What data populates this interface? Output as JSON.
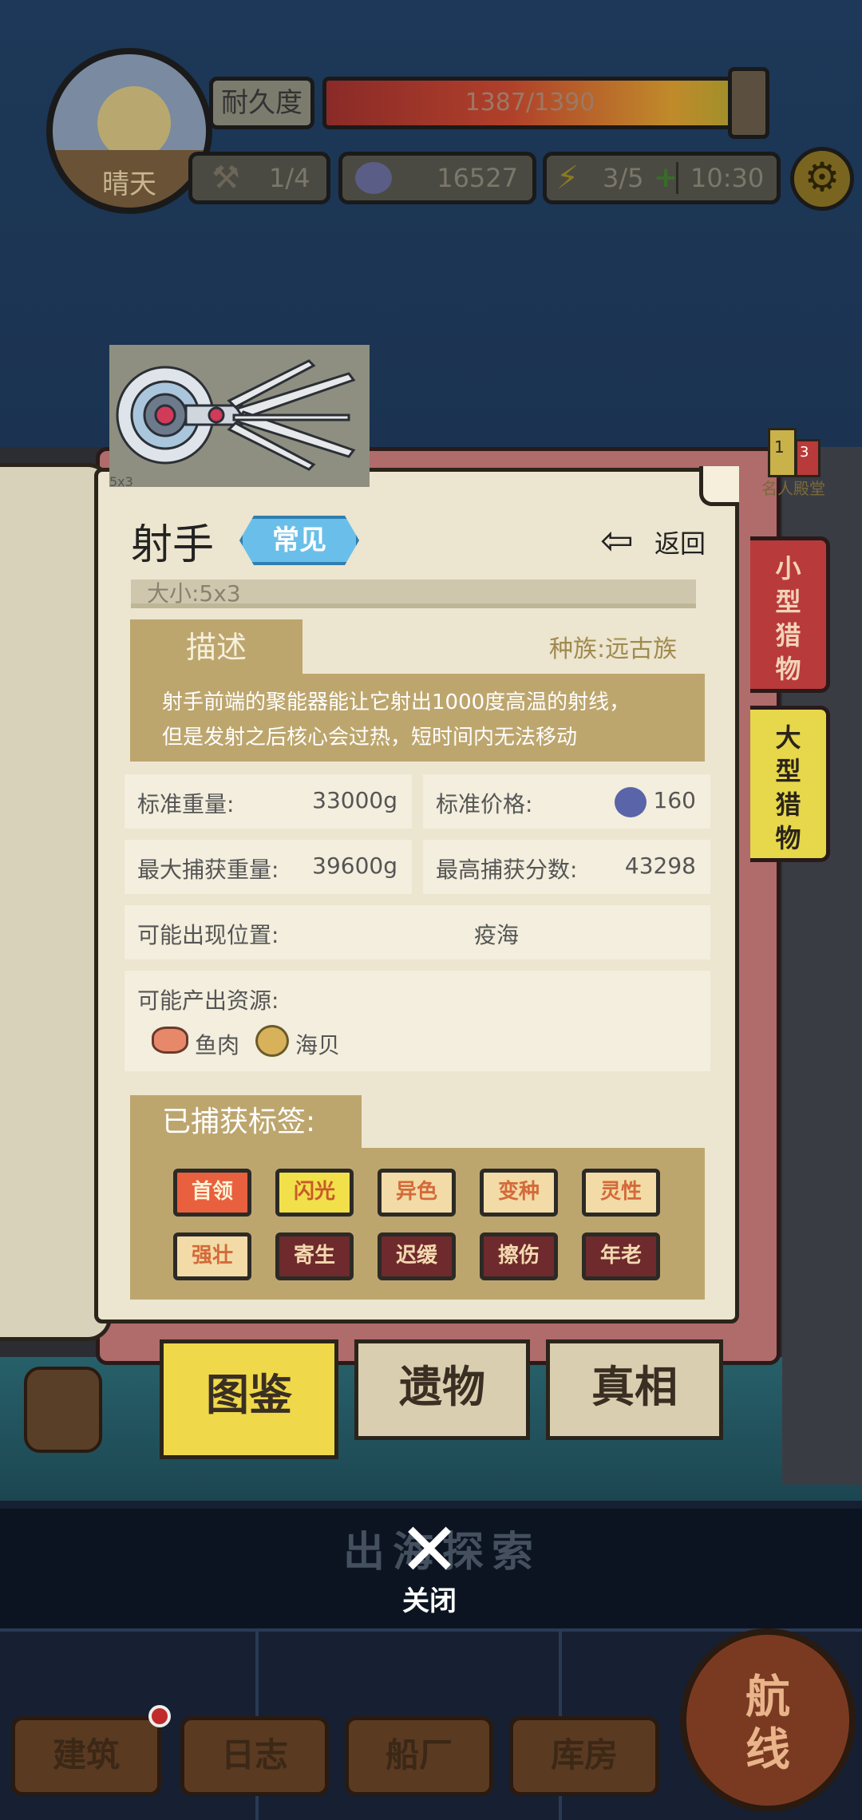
{
  "hud": {
    "weather": "晴天",
    "durability_label": "耐久度",
    "durability_text": "1387/1390",
    "durability_fraction": 0.9978,
    "tools": "1/4",
    "currency": "16527",
    "energy": "3/5",
    "timer": "10:30"
  },
  "thumbnail_label": "5x3",
  "card": {
    "name": "射手",
    "rarity": "常见",
    "back_label": "返回",
    "size": "大小:5x3",
    "desc_title": "描述",
    "race": "种族:远古族",
    "description": [
      "射手前端的聚能器能让它射出1000度高温的射线，",
      "但是发射之后核心会过热，短时间内无法移动"
    ],
    "std_weight_label": "标准重量:",
    "std_weight": "33000g",
    "std_price_label": "标准价格:",
    "std_price": "160",
    "max_weight_label": "最大捕获重量:",
    "max_weight": "39600g",
    "max_score_label": "最高捕获分数:",
    "max_score": "43298",
    "location_label": "可能出现位置:",
    "location": "疫海",
    "resources_label": "可能产出资源:",
    "resources": [
      "鱼肉",
      "海贝"
    ],
    "tags_title": "已捕获标签:",
    "tags": [
      {
        "label": "首领",
        "bg": "#e8603e",
        "fg": "#fff3d6"
      },
      {
        "label": "闪光",
        "bg": "#f1e04a",
        "fg": "#c85a2a"
      },
      {
        "label": "异色",
        "bg": "#f2dba6",
        "fg": "#d46a3a"
      },
      {
        "label": "变种",
        "bg": "#f2dba6",
        "fg": "#d46a3a"
      },
      {
        "label": "灵性",
        "bg": "#f2dba6",
        "fg": "#d46a3a"
      },
      {
        "label": "强壮",
        "bg": "#f2dba6",
        "fg": "#d46a3a"
      },
      {
        "label": "寄生",
        "bg": "#6e2a2c",
        "fg": "#f4d9b0"
      },
      {
        "label": "迟缓",
        "bg": "#6e2a2c",
        "fg": "#f4d9b0"
      },
      {
        "label": "擦伤",
        "bg": "#6e2a2c",
        "fg": "#f4d9b0"
      },
      {
        "label": "年老",
        "bg": "#6e2a2c",
        "fg": "#f4d9b0"
      }
    ]
  },
  "side_tabs": {
    "small": "小型猎物",
    "large": "大型猎物",
    "ribbon_num1": "1",
    "ribbon_num2": "3",
    "ribbon_label": "名人殿堂"
  },
  "bottom_tabs": [
    "图鉴",
    "遗物",
    "真相"
  ],
  "explore_label": "出海探索",
  "close_label": "关闭",
  "nav": [
    "建筑",
    "日志",
    "船厂",
    "库房"
  ],
  "route_label": "航线"
}
